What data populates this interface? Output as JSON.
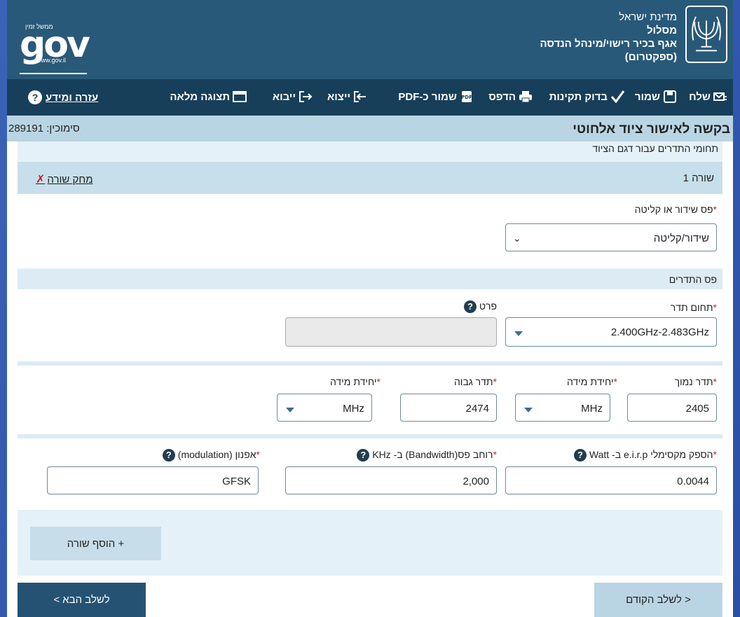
{
  "header": {
    "ministry_line1": "מדינת ישראל",
    "ministry_line2": "מסלול",
    "ministry_line3": "אגף בכיר רישוי/מינהל הנדסה",
    "ministry_line4": "(ספקטרום)",
    "logo_small": "ממשל זמין",
    "logo_big": "gov",
    "logo_url": "www.gov.il"
  },
  "toolbar": {
    "send": "שלח",
    "save": "שמור",
    "validate": "בדוק תקינות",
    "print": "הדפס",
    "save_pdf": "שמור כ-PDF",
    "export": "ייצוא",
    "import": "ייבוא",
    "full_view": "תצוגה מלאה",
    "help": "עזרה ומידע",
    "help_icon": "?"
  },
  "titlebar": {
    "title": "בקשה לאישור ציוד אלחוטי",
    "ref_label": "סימוכין:",
    "ref_value": "289191"
  },
  "section": {
    "subtitle": "תחומי התדרים עבור דגם הציוד",
    "row_label": "שורה 1",
    "delete_row": "מחק שורה"
  },
  "band_select": {
    "label": "פס שידור או קליטה",
    "value": "שידור/קליטה"
  },
  "freq_band_heading": "פס התדרים",
  "freq_range": {
    "label": "תחום תדר",
    "value": "2.400GHz-2.483GHz"
  },
  "detail": {
    "label": "פרט",
    "value": ""
  },
  "low_freq": {
    "label": "תדר נמוך",
    "value": "2405"
  },
  "low_unit": {
    "label": "יחידת מידה",
    "value": "MHz"
  },
  "high_freq": {
    "label": "תדר גבוה",
    "value": "2474"
  },
  "high_unit": {
    "label": "יחידת מידה",
    "value": "MHz"
  },
  "eirp": {
    "label": "הספק מקסימלי e.i.r.p ב- Watt",
    "value": "0.0044"
  },
  "bandwidth": {
    "label": "רוחב פס(Bandwidth) ב- KHz",
    "value": "2,000"
  },
  "modulation": {
    "label": "אפנון (modulation)",
    "value": "GFSK"
  },
  "required_mark": "*",
  "help_mark": "?",
  "add_row": "+ הוסף שורה",
  "nav": {
    "prev": "< לשלב הקודם",
    "next": "לשלב הבא >"
  },
  "colors": {
    "header": "#295979",
    "toolbar": "#173f5a",
    "titlebar": "#b9d5e3",
    "next_button": "#255273",
    "prev_button": "#b9d5e3"
  }
}
